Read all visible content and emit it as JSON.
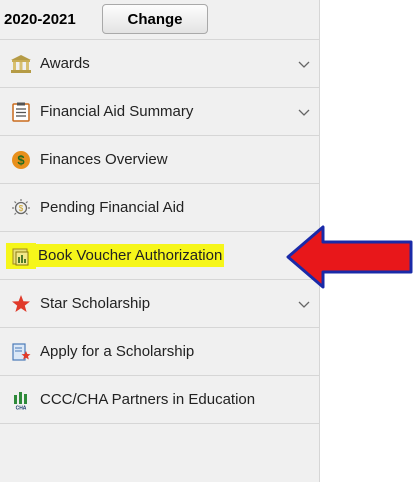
{
  "term": {
    "year": "2020-2021",
    "change_label": "Change"
  },
  "nav": {
    "items": [
      {
        "label": "Awards",
        "icon": "awards-icon",
        "expandable": true
      },
      {
        "label": "Financial Aid Summary",
        "icon": "summary-icon",
        "expandable": true
      },
      {
        "label": "Finances Overview",
        "icon": "dollar-icon",
        "expandable": false
      },
      {
        "label": "Pending Financial Aid",
        "icon": "pending-icon",
        "expandable": false
      },
      {
        "label": "Book Voucher Authorization",
        "icon": "voucher-icon",
        "expandable": false,
        "highlighted": true
      },
      {
        "label": "Star Scholarship",
        "icon": "star-icon",
        "expandable": true
      },
      {
        "label": "Apply for a Scholarship",
        "icon": "apply-icon",
        "expandable": false
      },
      {
        "label": "CCC/CHA Partners in Education",
        "icon": "cha-icon",
        "expandable": false
      }
    ]
  },
  "colors": {
    "highlight": "#f6f61a",
    "arrow": "#e8171a",
    "arrow_outline": "#1a2aa8",
    "star": "#e03a2a",
    "dollar": "#e8901c"
  }
}
